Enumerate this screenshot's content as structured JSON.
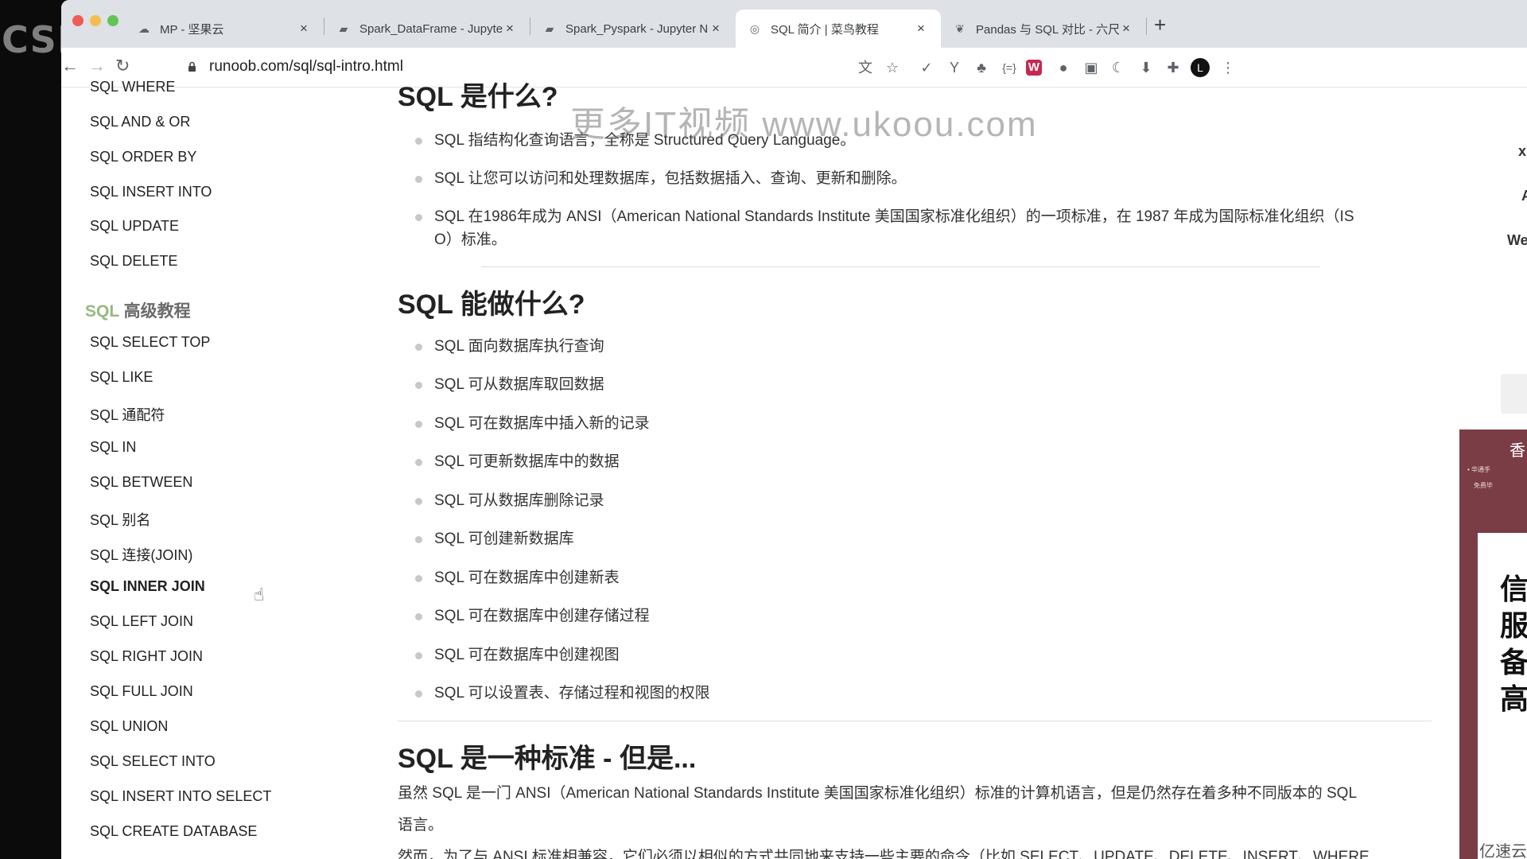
{
  "overlay": {
    "logo_text": "CSDn直播"
  },
  "browser": {
    "tabs": [
      {
        "title": "MP - 坚果云"
      },
      {
        "title": "Spark_DataFrame - Jupyter Note"
      },
      {
        "title": "Spark_Pyspark - Jupyter Note"
      },
      {
        "title": "SQL 简介 | 菜鸟教程"
      },
      {
        "title": "Pandas 与 SQL 对比 - 六尺巷人"
      }
    ],
    "new_tab": "+",
    "close_glyph": "×",
    "url": "runoob.com/sql/sql-intro.html",
    "profile_initial": "L"
  },
  "sidebar": {
    "top_items": [
      "SQL WHERE",
      "SQL AND & OR",
      "SQL ORDER BY",
      "SQL INSERT INTO",
      "SQL UPDATE",
      "SQL DELETE"
    ],
    "heading_sql": "SQL",
    "heading_rest": "高级教程",
    "advanced_items": [
      "SQL SELECT TOP",
      "SQL LIKE",
      "SQL 通配符",
      "SQL IN",
      "SQL BETWEEN",
      "SQL 别名",
      "SQL 连接(JOIN)",
      "SQL INNER JOIN",
      "SQL LEFT JOIN",
      "SQL RIGHT JOIN",
      "SQL FULL JOIN",
      "SQL UNION",
      "SQL SELECT INTO",
      "SQL INSERT INTO SELECT",
      "SQL CREATE DATABASE"
    ],
    "active_item": "SQL INNER JOIN"
  },
  "content": {
    "section1": {
      "heading": "SQL 是什么?",
      "items": [
        "SQL 指结构化查询语言，全称是 Structured Query Language。",
        "SQL 让您可以访问和处理数据库，包括数据插入、查询、更新和删除。",
        "SQL 在1986年成为 ANSI（American National Standards Institute 美国国家标准化组织）的一项标准，在 1987 年成为国际标准化组织（IS",
        "O）标准。"
      ]
    },
    "section2": {
      "heading": "SQL 能做什么?",
      "items": [
        "SQL 面向数据库执行查询",
        "SQL 可从数据库取回数据",
        "SQL 可在数据库中插入新的记录",
        "SQL 可更新数据库中的数据",
        "SQL 可从数据库删除记录",
        "SQL 可创建新数据库",
        "SQL 可在数据库中创建新表",
        "SQL 可在数据库中创建存储过程",
        "SQL 可在数据库中创建视图",
        "SQL 可以设置表、存储过程和视图的权限"
      ]
    },
    "section3": {
      "heading": "SQL 是一种标准 - 但是...",
      "para_lines": [
        "虽然 SQL 是一门 ANSI（American National Standards Institute 美国国家标准化组织）标准的计算机语言，但是仍然存在着多种不同版本的 SQL",
        "语言。",
        "然而，为了与 ANSI 标准相兼容，它们必须以相似的方式共同地来支持一些主要的命令（比如 SELECT、UPDATE、DELETE、INSERT、WHERE"
      ]
    }
  },
  "watermark": "更多IT视频 www.ukoou.com",
  "right_ad": {
    "top_char": "香",
    "small_lines": [
      "• 华通手",
      "免费毕"
    ],
    "big_chars": [
      "信",
      "服",
      "备",
      "高"
    ],
    "bottom_text": "亿速云"
  },
  "right_edge": {
    "letters": [
      "x",
      "A",
      "We"
    ]
  }
}
